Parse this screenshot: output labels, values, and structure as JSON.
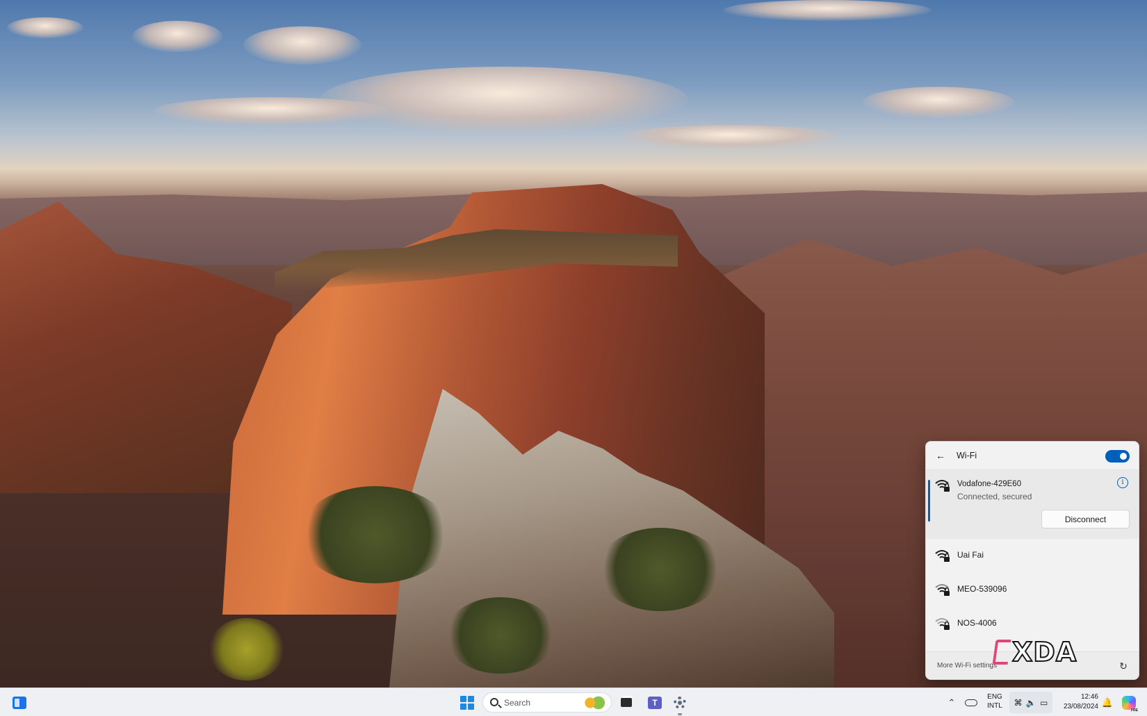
{
  "wifi_panel": {
    "title": "Wi-Fi",
    "toggle_on": true,
    "connected_network": {
      "name": "Vodafone-429E60",
      "status": "Connected, secured",
      "disconnect_label": "Disconnect"
    },
    "networks": [
      {
        "name": "Uai Fai"
      },
      {
        "name": "MEO-539096"
      },
      {
        "name": "NOS-4006"
      }
    ],
    "more_settings_label": "More Wi-Fi settings"
  },
  "watermark": {
    "text": "XDA"
  },
  "taskbar": {
    "search_placeholder": "Search",
    "language": "ENG",
    "layout": "INTL",
    "time": "12:46",
    "date": "23/08/2024"
  },
  "colors": {
    "accent": "#005fb8",
    "taskbar_bg": "#eef0f4",
    "flyout_bg": "#f2f2f2"
  }
}
